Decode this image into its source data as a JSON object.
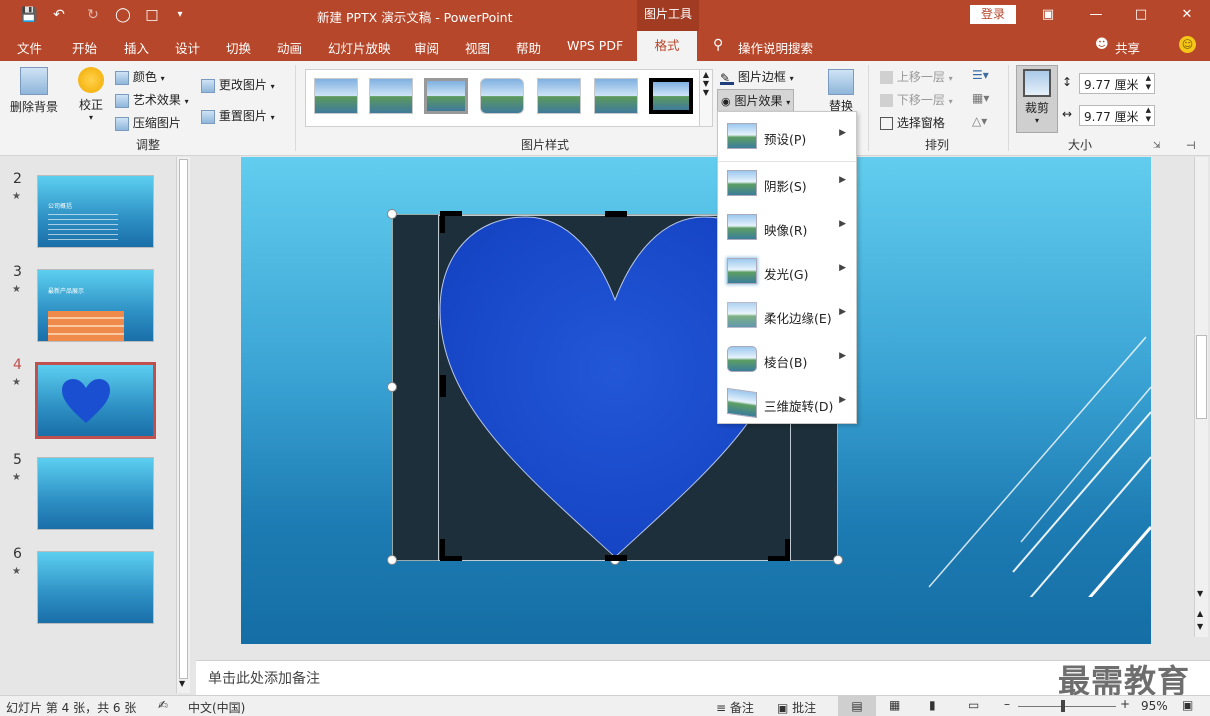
{
  "title_bar": {
    "doc_title": "新建 PPTX 演示文稿 - PowerPoint",
    "context_tab_header": "图片工具",
    "login": "登录",
    "share": "共享"
  },
  "tabs": [
    "文件",
    "开始",
    "插入",
    "设计",
    "切换",
    "动画",
    "幻灯片放映",
    "审阅",
    "视图",
    "帮助",
    "WPS PDF",
    "格式"
  ],
  "tell_me": "操作说明搜索",
  "ribbon": {
    "adjust": {
      "remove_bg": "删除背景",
      "correct": "校正",
      "color": "颜色",
      "artistic": "艺术效果",
      "compress": "压缩图片",
      "change": "更改图片",
      "reset": "重置图片",
      "group_label": "调整"
    },
    "styles": {
      "border": "图片边框",
      "effects": "图片效果",
      "group_label": "图片样式",
      "alt_text_partial": "替换"
    },
    "arrange": {
      "bring_forward": "上移一层",
      "send_backward": "下移一层",
      "selection_pane": "选择窗格",
      "group_label": "排列"
    },
    "size": {
      "crop": "裁剪",
      "height": "9.77 厘米",
      "width": "9.77 厘米",
      "group_label": "大小"
    }
  },
  "effects_menu": [
    {
      "label": "预设(P)"
    },
    {
      "label": "阴影(S)"
    },
    {
      "label": "映像(R)"
    },
    {
      "label": "发光(G)"
    },
    {
      "label": "柔化边缘(E)"
    },
    {
      "label": "棱台(B)"
    },
    {
      "label": "三维旋转(D)"
    }
  ],
  "slides": [
    {
      "num": "2",
      "caption": "公司概括"
    },
    {
      "num": "3",
      "caption": "最新产品展示"
    },
    {
      "num": "4",
      "caption": ""
    },
    {
      "num": "5",
      "caption": ""
    },
    {
      "num": "6",
      "caption": ""
    }
  ],
  "notes_placeholder": "单击此处添加备注",
  "status": {
    "slide_info": "幻灯片 第 4 张，共 6 张",
    "language": "中文(中国)",
    "notes_btn": "备注",
    "comments_btn": "批注",
    "zoom": "95%"
  },
  "watermark": "最需教育",
  "colors": {
    "accent": "#b7472a",
    "selected_slide_border": "#c0504d",
    "heart": "#1a4fd1"
  }
}
